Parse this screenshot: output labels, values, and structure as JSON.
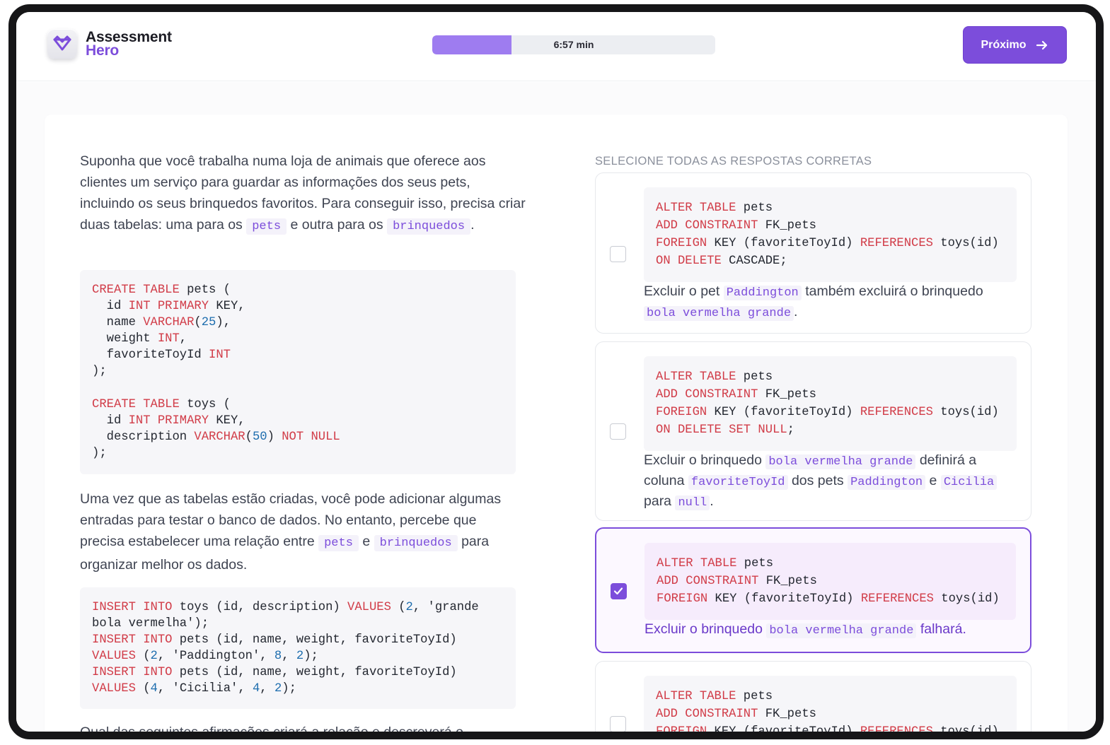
{
  "brand": {
    "name_line1": "Assessment",
    "name_line2": "Hero"
  },
  "timer": {
    "text": "6:57 min",
    "elapsed_fraction": 0.28
  },
  "next_button": {
    "label": "Próximo"
  },
  "question": {
    "para1": {
      "text1": "Suponha que você trabalha numa loja de animais que oferece aos clientes um serviço para guardar as informações dos seus pets, incluindo os seus brinquedos favoritos. Para conseguir isso, precisa criar duas tabelas: uma para os",
      "code1": "pets",
      "text2": "e outra para os",
      "code2": "brinquedos",
      "text3": "."
    },
    "para2": {
      "text1": "Uma vez que as tabelas estão criadas, você pode adicionar algumas entradas para testar o banco de dados. No entanto, percebe que precisa estabelecer uma relação entre",
      "code1": "pets",
      "text2": "e",
      "code2": "brinquedos",
      "text3": "para organizar melhor os dados."
    },
    "para3": {
      "text": "Qual das seguintes afirmações criará a relação e descreverá o"
    }
  },
  "selection": {
    "label": "SELECIONE TODAS AS RESPOSTAS CORRETAS"
  },
  "options": [
    {
      "selected": false,
      "text1": "Excluir o pet",
      "code1": "Paddington",
      "text2": "também excluirá o brinquedo",
      "code2": "bola vermelha grande",
      "text3": "."
    },
    {
      "selected": false,
      "text1": "Excluir o brinquedo",
      "code1": "bola vermelha grande",
      "text2": "definirá a coluna",
      "code2": "favoriteToyId",
      "text3": "dos pets",
      "code3": "Paddington",
      "text4": "e",
      "code4": "Cicilia",
      "text5": "para",
      "code5": "null",
      "text6": "."
    },
    {
      "selected": true,
      "text1": "Excluir o brinquedo",
      "code1": "bola vermelha grande",
      "text2": "falhará."
    },
    {
      "selected": false
    }
  ],
  "colors": {
    "accent": "#7c4ddb",
    "keyword": "#d13c48",
    "number": "#1d6dae",
    "progress": "#9e7cf0"
  },
  "icons": [
    "logo-heart-icon",
    "arrow-right-icon",
    "checkmark-icon"
  ]
}
